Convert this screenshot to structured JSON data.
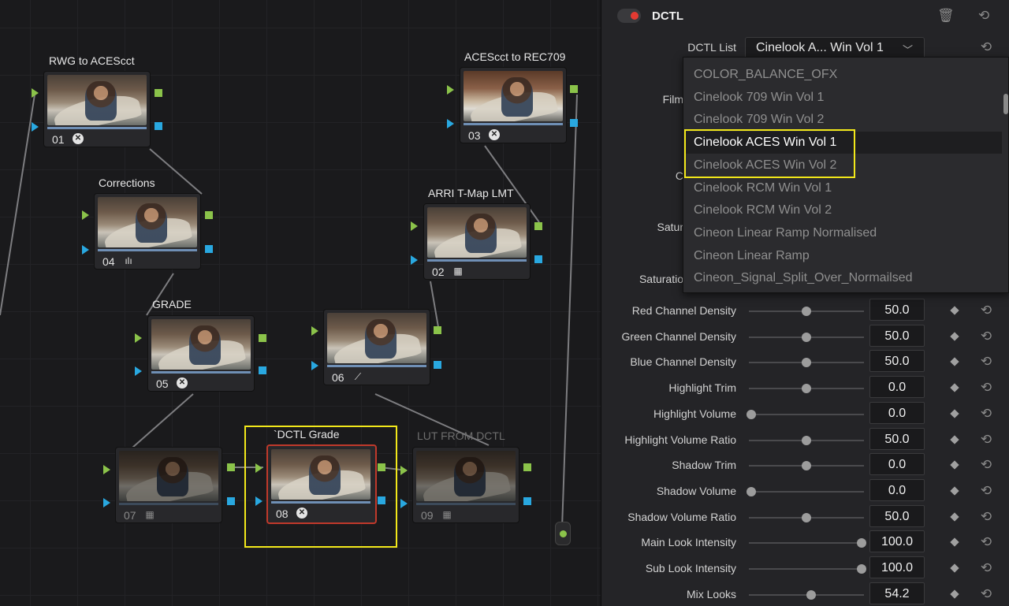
{
  "node_editor": {
    "nodes": [
      {
        "id": "01",
        "title": "RWG to ACEScct",
        "glyph": "ⓧ",
        "glyph_kind": "circle",
        "dim": false
      },
      {
        "id": "03",
        "title": "ACEScct to REC709",
        "glyph": "ⓧ",
        "glyph_kind": "circle",
        "dim": false
      },
      {
        "id": "04",
        "title": "Corrections",
        "glyph": "ılı",
        "glyph_kind": "bars",
        "dim": false
      },
      {
        "id": "02",
        "title": "ARRI T-Map LMT",
        "glyph": "▦",
        "glyph_kind": "grid",
        "dim": false
      },
      {
        "id": "05",
        "title": "GRADE",
        "glyph": "ⓧ",
        "glyph_kind": "circle",
        "dim": false
      },
      {
        "id": "06",
        "title": "",
        "glyph": "⟋",
        "glyph_kind": "curve",
        "dim": false
      },
      {
        "id": "07",
        "title": "",
        "glyph": "▦",
        "glyph_kind": "grid",
        "dim": true
      },
      {
        "id": "08",
        "title": "`DCTL Grade",
        "glyph": "ⓧ",
        "glyph_kind": "circle",
        "dim": false
      },
      {
        "id": "09",
        "title": "LUT FROM DCTL",
        "glyph": "▦",
        "glyph_kind": "grid",
        "dim": true
      }
    ]
  },
  "inspector": {
    "title": "DCTL",
    "dctl_list_label": "DCTL List",
    "dctl_list_value": "Cinelook A... Win Vol 1",
    "partial_labels": [
      "Film",
      "C",
      "Satur",
      "Saturatio"
    ],
    "params": [
      {
        "label": "Red Channel Density",
        "value": "50.0",
        "fraction": 0.5
      },
      {
        "label": "Green Channel Density",
        "value": "50.0",
        "fraction": 0.5
      },
      {
        "label": "Blue Channel Density",
        "value": "50.0",
        "fraction": 0.5
      },
      {
        "label": "Highlight Trim",
        "value": "0.0",
        "fraction": 0.5
      },
      {
        "label": "Highlight Volume",
        "value": "0.0",
        "fraction": 0.0
      },
      {
        "label": "Highlight Volume Ratio",
        "value": "50.0",
        "fraction": 0.5
      },
      {
        "label": "Shadow Trim",
        "value": "0.0",
        "fraction": 0.5
      },
      {
        "label": "Shadow Volume",
        "value": "0.0",
        "fraction": 0.0
      },
      {
        "label": "Shadow Volume Ratio",
        "value": "50.0",
        "fraction": 0.5
      },
      {
        "label": "Main Look Intensity",
        "value": "100.0",
        "fraction": 1.0
      },
      {
        "label": "Sub Look Intensity",
        "value": "100.0",
        "fraction": 1.0
      },
      {
        "label": "Mix Looks",
        "value": "54.2",
        "fraction": 0.542
      }
    ]
  },
  "dropdown": {
    "items": [
      "COLOR_BALANCE_OFX",
      "Cinelook 709 Win Vol 1",
      "Cinelook 709 Win Vol 2",
      "Cinelook ACES Win Vol 1",
      "Cinelook ACES Win Vol 2",
      "Cinelook RCM Win Vol 1",
      "Cinelook RCM Win Vol 2",
      "Cineon Linear Ramp Normalised",
      "Cineon Linear Ramp",
      "Cineon_Signal_Split_Over_Normailsed"
    ],
    "selected_index": 3
  },
  "icons": {
    "trash": "trash-icon",
    "reset_all": "reset-all-icon",
    "reset": "reset-icon",
    "chevron": "chevron-down-icon",
    "keyframe": "keyframe-diamond-icon"
  },
  "colors": {
    "highlight_box": "#f2e81a",
    "selected_node_border": "#c0392b",
    "port_green": "#8bc34a",
    "port_blue": "#29a8e0",
    "toggle_led": "#e33a32"
  }
}
